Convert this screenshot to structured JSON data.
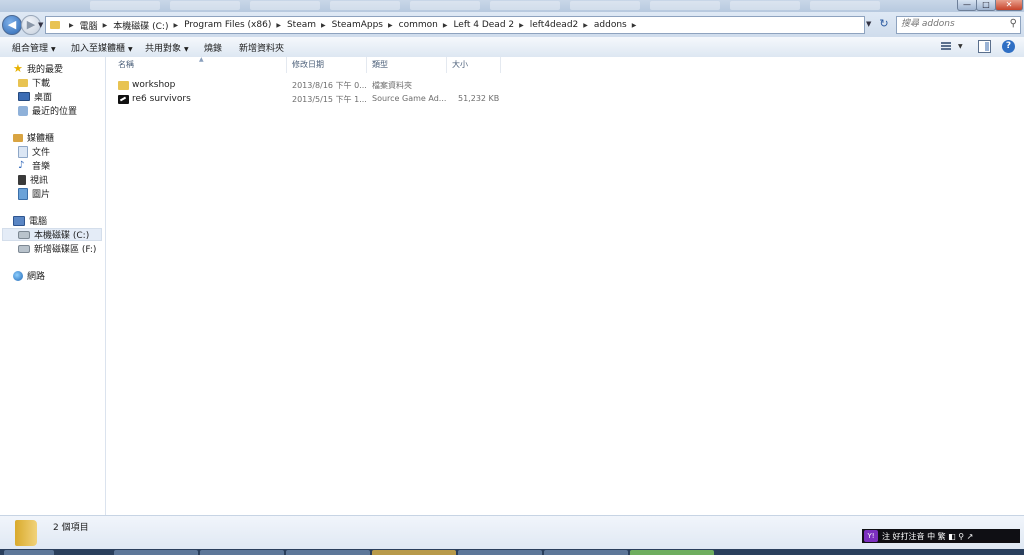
{
  "window": {
    "controls": {
      "minimize": "—",
      "maximize": "□",
      "close": "✕"
    }
  },
  "address": {
    "breadcrumbs": [
      "電腦",
      "本機磁碟 (C:)",
      "Program Files (x86)",
      "Steam",
      "SteamApps",
      "common",
      "Left 4 Dead 2",
      "left4dead2",
      "addons"
    ],
    "search_placeholder": "搜尋 addons"
  },
  "toolbar": {
    "organize": "組合管理",
    "include_in_library": "加入至媒體櫃",
    "share_with": "共用對象",
    "burn": "燒錄",
    "new_folder": "新增資料夾"
  },
  "nav": {
    "favorites": {
      "label": "我的最愛",
      "items": [
        "下載",
        "桌面",
        "最近的位置"
      ]
    },
    "libraries": {
      "label": "媒體櫃",
      "items": [
        "文件",
        "音樂",
        "視訊",
        "圖片"
      ]
    },
    "computer": {
      "label": "電腦",
      "items": [
        "本機磁碟 (C:)",
        "新增磁碟區 (F:)"
      ]
    },
    "network": {
      "label": "網路"
    }
  },
  "columns": {
    "name": "名稱",
    "date": "修改日期",
    "type": "類型",
    "size": "大小"
  },
  "files": [
    {
      "name": "workshop",
      "date": "2013/8/16 下午 0...",
      "type": "檔案資料夾",
      "size": "",
      "icon": "folder-icon"
    },
    {
      "name": "re6 survivors",
      "date": "2013/5/15 下午 1...",
      "type": "Source Game Ad...",
      "size": "51,232 KB",
      "icon": "vpk-file-icon"
    }
  ],
  "status": {
    "item_count": "2 個項目"
  },
  "ime": {
    "logo": "Y!",
    "text": "注 好打注音  中 繁 ◧ ⚲ ↗"
  },
  "colors": {
    "accent": "#2d67b2",
    "selection": "#e4ecf7",
    "folder": "#e8c352"
  }
}
